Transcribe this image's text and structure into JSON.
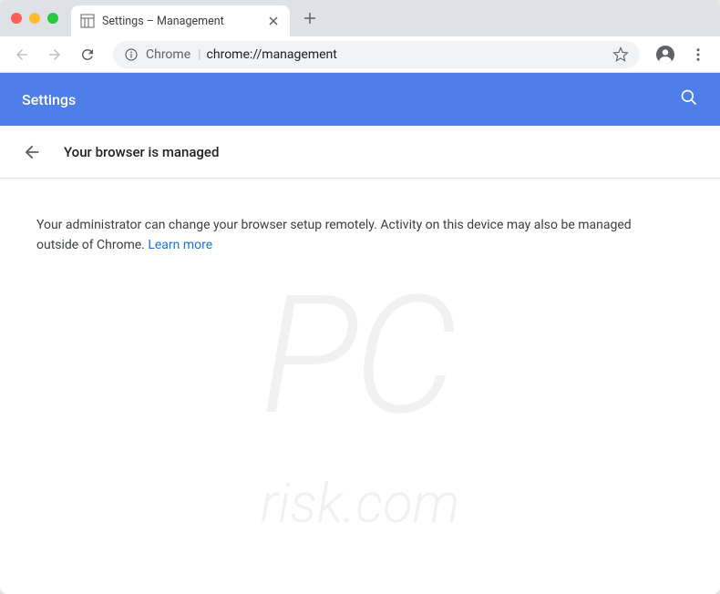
{
  "window": {
    "tab": {
      "title": "Settings – Management"
    }
  },
  "omnibox": {
    "prefix": "Chrome",
    "url": "chrome://management"
  },
  "settings": {
    "title": "Settings"
  },
  "page": {
    "heading": "Your browser is managed",
    "body": "Your administrator can change your browser setup remotely. Activity on this device may also be managed outside of Chrome. ",
    "learn_more": "Learn more"
  },
  "watermark": {
    "main": "PC",
    "sub": "risk.com"
  }
}
